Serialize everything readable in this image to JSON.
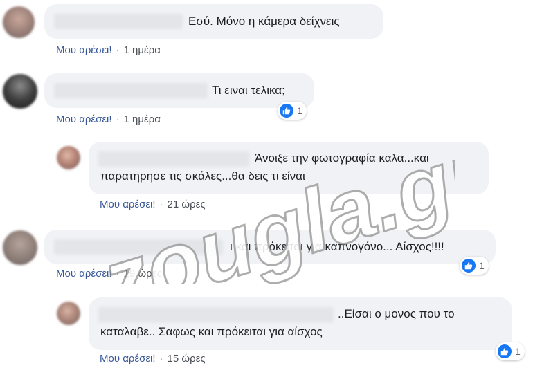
{
  "comments": [
    {
      "text": "Εσύ. Μόνο η κάμερα δείχνεις",
      "like_label": "Μου αρέσει!",
      "separator": "·",
      "time": "1 ημέρα",
      "reaction_count": ""
    },
    {
      "text": "Τι ειναι τελικα;",
      "like_label": "Μου αρέσει!",
      "separator": "·",
      "time": "1 ημέρα",
      "reaction_count": "1"
    },
    {
      "text_line1": "Άνοιξε την φωτογραφία καλα...και",
      "text_line2": "παρατηρησε τις σκάλες...θα δεις τι είναι",
      "like_label": "Μου αρέσει!",
      "separator": "·",
      "time": "21 ώρες",
      "reaction_count": ""
    },
    {
      "text": "ι και πρόκειται για καπνογόνο... Αίσχος!!!!",
      "like_label": "Μου αρέσει!",
      "separator": "·",
      "time": "19 ώρες",
      "reaction_count": "1"
    },
    {
      "text_line1": "..Είσαι ο μονος που το",
      "text_line2": "καταλαβε.. Σαφως και πρόκειται για αίσχος",
      "like_label": "Μου αρέσει!",
      "separator": "·",
      "time": "15 ώρες",
      "reaction_count": "1"
    }
  ],
  "watermark": {
    "text": "zougla.gr"
  },
  "colors": {
    "bubble_bg": "#f0f2f5",
    "like_link": "#385898",
    "like_badge": "#1877f2",
    "watermark": "#ffffff"
  },
  "icons": {
    "reaction": "thumbs-up-icon",
    "avatar": "user-avatar"
  }
}
